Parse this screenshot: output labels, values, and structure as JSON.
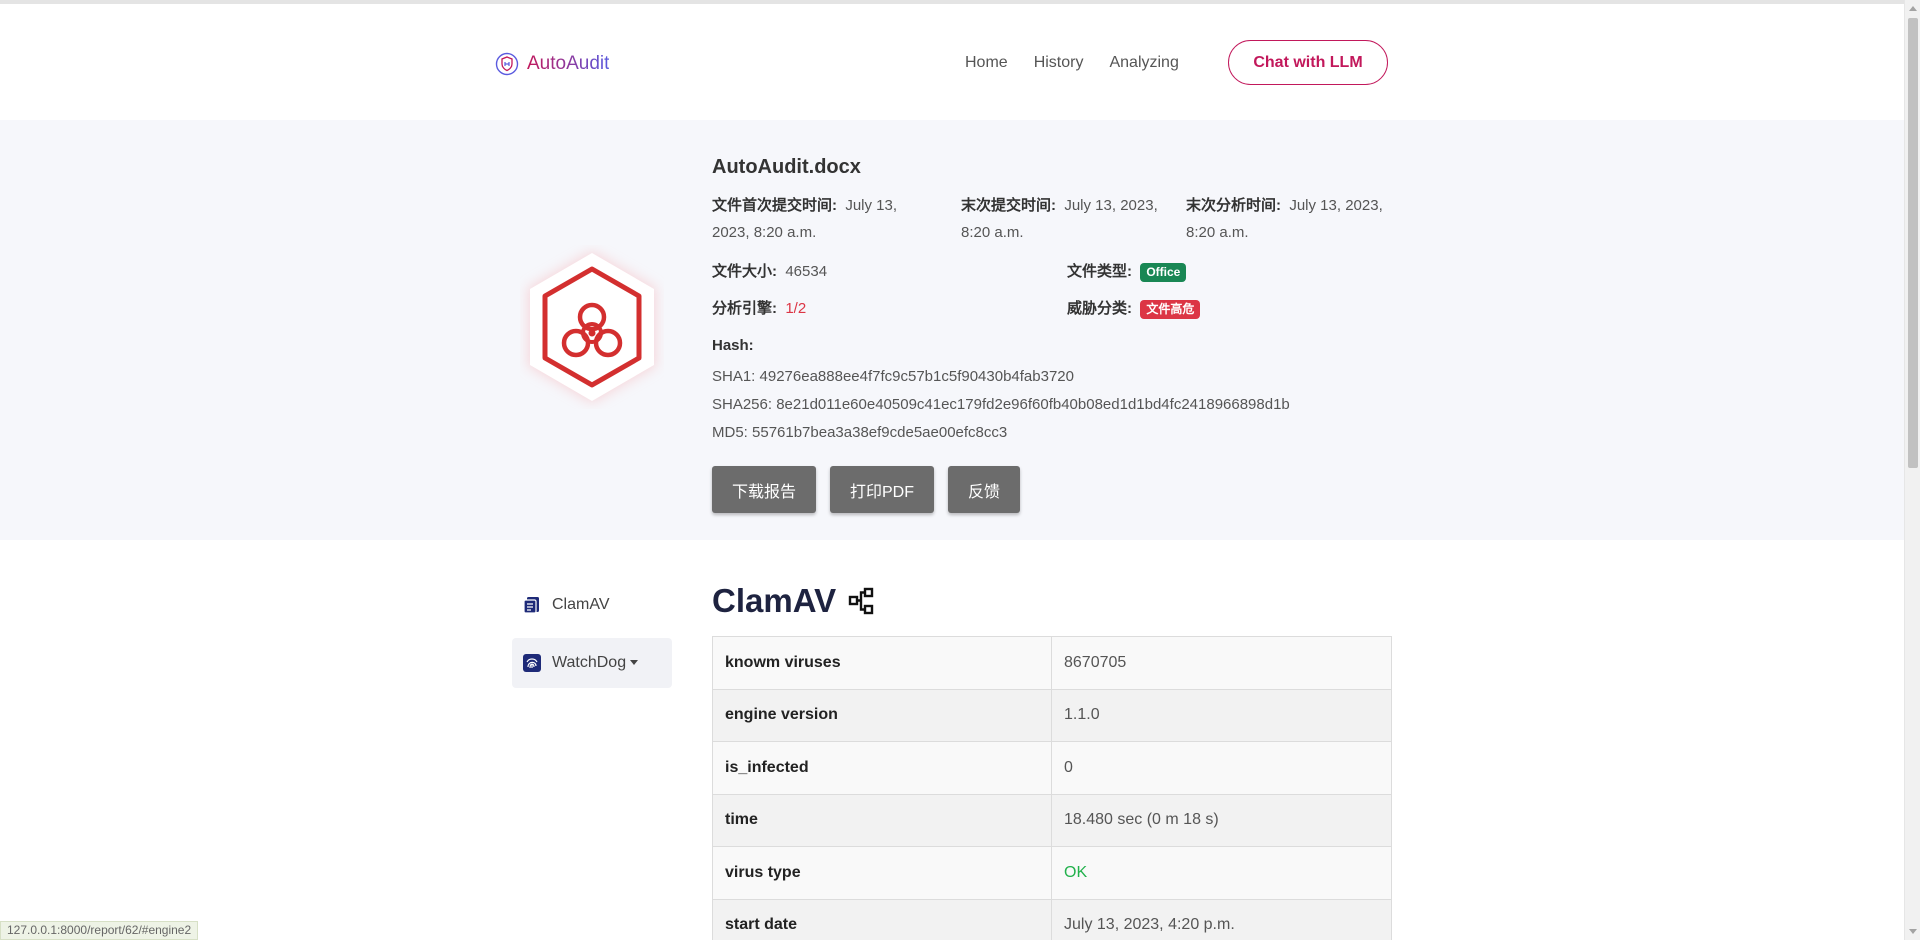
{
  "header": {
    "brand": "AutoAudit",
    "nav": [
      "Home",
      "History",
      "Analyzing"
    ],
    "chat_label": "Chat with LLM"
  },
  "report": {
    "file_name": "AutoAudit.docx",
    "first_submit_label": "文件首次提交时间:",
    "first_submit_value": "July 13, 2023, 8:20 a.m.",
    "last_submit_label": "末次提交时间:",
    "last_submit_value": "July 13, 2023, 8:20 a.m.",
    "last_analysis_label": "末次分析时间:",
    "last_analysis_value": "July 13, 2023, 8:20 a.m.",
    "size_label": "文件大小:",
    "size_value": "46534",
    "type_label": "文件类型:",
    "type_value": "Office",
    "engines_label": "分析引擎:",
    "engines_value": "1/2",
    "threat_label": "威胁分类:",
    "threat_value": "文件高危",
    "hash_label": "Hash:",
    "sha1": "SHA1: 49276ea888ee4f7fc9c57b1c5f90430b4fab3720",
    "sha256": "SHA256: 8e21d011e60e40509c41ec179fd2e96f60fb40b08ed1d1bd4fc2418966898d1b",
    "md5": "MD5: 55761b7bea3a38ef9cde5ae00efc8cc3",
    "buttons": [
      "下载报告",
      "打印PDF",
      "反馈"
    ]
  },
  "sidebar": {
    "items": [
      {
        "label": "ClamAV"
      },
      {
        "label": "WatchDog"
      }
    ]
  },
  "engine": {
    "title": "ClamAV",
    "rows": [
      {
        "key": "knowm viruses",
        "value": "8670705"
      },
      {
        "key": "engine version",
        "value": "1.1.0"
      },
      {
        "key": "is_infected",
        "value": "0"
      },
      {
        "key": "time",
        "value": "18.480 sec (0 m 18 s)"
      },
      {
        "key": "virus type",
        "value": "OK"
      },
      {
        "key": "start date",
        "value": "July 13, 2023, 4:20 p.m."
      }
    ]
  },
  "status_url": "127.0.0.1:8000/report/62/#engine2",
  "colors": {
    "accent": "#c2185b",
    "badge_red": "#d32f2f",
    "ok_green": "#22b14c"
  }
}
